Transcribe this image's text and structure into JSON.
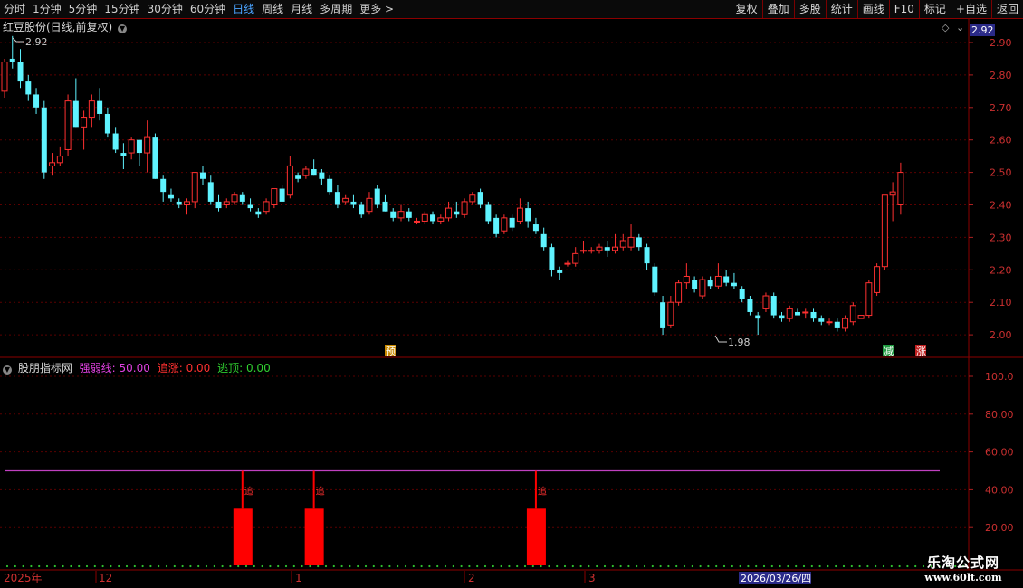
{
  "toolbar": {
    "periods": [
      "分时",
      "1分钟",
      "5分钟",
      "15分钟",
      "30分钟",
      "60分钟",
      "日线",
      "周线",
      "月线",
      "多周期",
      "更多 >"
    ],
    "active_period": "日线",
    "actions": [
      "复权",
      "叠加",
      "多股",
      "统计",
      "画线",
      "F10",
      "标记",
      "+自选",
      "返回"
    ]
  },
  "main_panel": {
    "title": "红豆股份(日线,前复权)",
    "current_price_label": "2.92",
    "high_label": "2.92",
    "low_label": "1.98",
    "price_axis": [
      "2.90",
      "2.80",
      "2.70",
      "2.60",
      "2.50",
      "2.40",
      "2.30",
      "2.20",
      "2.10",
      "2.00"
    ],
    "markers": [
      {
        "text": "预",
        "color": "#e0b000"
      },
      {
        "text": "减",
        "color": "#20b040"
      },
      {
        "text": "涨",
        "color": "#ff3030"
      }
    ]
  },
  "indicator_panel": {
    "title": "股朋指标网",
    "legend": [
      {
        "label": "强弱线: 50.00",
        "color": "#e040e0"
      },
      {
        "label": "追涨: 0.00",
        "color": "#ff3030"
      },
      {
        "label": "逃顶: 0.00",
        "color": "#30d030"
      }
    ],
    "axis": [
      "100.0",
      "80.00",
      "60.00",
      "40.00",
      "20.00"
    ],
    "signal_label": "追",
    "strength_line": 50
  },
  "time_axis": {
    "labels": [
      "2025年",
      "12",
      "1",
      "2",
      "3"
    ],
    "cursor_date": "2026/03/26/四"
  },
  "watermark": {
    "line1": "乐淘公式网",
    "line2": "www.60lt.com"
  },
  "chart_data": [
    {
      "type": "candlestick",
      "title": "红豆股份(日线,前复权)",
      "ylim": [
        1.95,
        2.95
      ],
      "up_color": "#ff3030",
      "down_color": "#5ff3ff",
      "candles": [
        [
          2.75,
          2.85,
          2.73,
          2.84
        ],
        [
          2.85,
          2.92,
          2.82,
          2.84
        ],
        [
          2.84,
          2.88,
          2.76,
          2.78
        ],
        [
          2.78,
          2.8,
          2.72,
          2.74
        ],
        [
          2.74,
          2.76,
          2.68,
          2.7
        ],
        [
          2.7,
          2.72,
          2.48,
          2.5
        ],
        [
          2.52,
          2.56,
          2.49,
          2.53
        ],
        [
          2.53,
          2.58,
          2.52,
          2.55
        ],
        [
          2.57,
          2.74,
          2.55,
          2.72
        ],
        [
          2.72,
          2.79,
          2.64,
          2.64
        ],
        [
          2.64,
          2.69,
          2.57,
          2.67
        ],
        [
          2.67,
          2.74,
          2.64,
          2.72
        ],
        [
          2.72,
          2.76,
          2.66,
          2.68
        ],
        [
          2.68,
          2.7,
          2.61,
          2.62
        ],
        [
          2.62,
          2.64,
          2.56,
          2.57
        ],
        [
          2.56,
          2.59,
          2.51,
          2.55
        ],
        [
          2.56,
          2.61,
          2.54,
          2.6
        ],
        [
          2.6,
          2.6,
          2.52,
          2.56
        ],
        [
          2.56,
          2.66,
          2.5,
          2.61
        ],
        [
          2.61,
          2.62,
          2.48,
          2.48
        ],
        [
          2.48,
          2.49,
          2.41,
          2.44
        ],
        [
          2.43,
          2.45,
          2.41,
          2.42
        ],
        [
          2.41,
          2.42,
          2.39,
          2.4
        ],
        [
          2.4,
          2.42,
          2.37,
          2.41
        ],
        [
          2.41,
          2.5,
          2.39,
          2.5
        ],
        [
          2.5,
          2.52,
          2.46,
          2.48
        ],
        [
          2.47,
          2.49,
          2.4,
          2.41
        ],
        [
          2.41,
          2.43,
          2.38,
          2.39
        ],
        [
          2.4,
          2.42,
          2.39,
          2.41
        ],
        [
          2.41,
          2.44,
          2.4,
          2.43
        ],
        [
          2.43,
          2.44,
          2.4,
          2.41
        ],
        [
          2.4,
          2.42,
          2.38,
          2.39
        ],
        [
          2.38,
          2.39,
          2.36,
          2.37
        ],
        [
          2.38,
          2.42,
          2.37,
          2.41
        ],
        [
          2.4,
          2.45,
          2.39,
          2.45
        ],
        [
          2.45,
          2.46,
          2.41,
          2.41
        ],
        [
          2.43,
          2.55,
          2.42,
          2.52
        ],
        [
          2.49,
          2.5,
          2.47,
          2.48
        ],
        [
          2.49,
          2.52,
          2.48,
          2.51
        ],
        [
          2.51,
          2.54,
          2.49,
          2.49
        ],
        [
          2.5,
          2.51,
          2.46,
          2.48
        ],
        [
          2.48,
          2.49,
          2.43,
          2.44
        ],
        [
          2.44,
          2.46,
          2.39,
          2.4
        ],
        [
          2.41,
          2.43,
          2.4,
          2.42
        ],
        [
          2.41,
          2.43,
          2.39,
          2.4
        ],
        [
          2.4,
          2.41,
          2.36,
          2.37
        ],
        [
          2.38,
          2.44,
          2.37,
          2.42
        ],
        [
          2.45,
          2.46,
          2.39,
          2.4
        ],
        [
          2.41,
          2.43,
          2.38,
          2.38
        ],
        [
          2.38,
          2.39,
          2.35,
          2.36
        ],
        [
          2.36,
          2.4,
          2.35,
          2.38
        ],
        [
          2.38,
          2.39,
          2.35,
          2.36
        ],
        [
          2.35,
          2.36,
          2.34,
          2.35
        ],
        [
          2.35,
          2.38,
          2.34,
          2.37
        ],
        [
          2.37,
          2.38,
          2.34,
          2.35
        ],
        [
          2.35,
          2.37,
          2.34,
          2.36
        ],
        [
          2.36,
          2.41,
          2.35,
          2.39
        ],
        [
          2.38,
          2.41,
          2.36,
          2.37
        ],
        [
          2.37,
          2.42,
          2.36,
          2.41
        ],
        [
          2.41,
          2.44,
          2.4,
          2.43
        ],
        [
          2.44,
          2.45,
          2.39,
          2.4
        ],
        [
          2.4,
          2.41,
          2.34,
          2.35
        ],
        [
          2.36,
          2.37,
          2.3,
          2.31
        ],
        [
          2.32,
          2.37,
          2.31,
          2.36
        ],
        [
          2.36,
          2.37,
          2.32,
          2.33
        ],
        [
          2.35,
          2.42,
          2.34,
          2.39
        ],
        [
          2.39,
          2.41,
          2.33,
          2.35
        ],
        [
          2.34,
          2.36,
          2.31,
          2.32
        ],
        [
          2.31,
          2.33,
          2.26,
          2.27
        ],
        [
          2.27,
          2.28,
          2.18,
          2.2
        ],
        [
          2.2,
          2.21,
          2.17,
          2.19
        ],
        [
          2.22,
          2.23,
          2.21,
          2.22
        ],
        [
          2.22,
          2.27,
          2.21,
          2.25
        ],
        [
          2.26,
          2.29,
          2.25,
          2.26
        ],
        [
          2.26,
          2.27,
          2.25,
          2.26
        ],
        [
          2.26,
          2.28,
          2.25,
          2.27
        ],
        [
          2.27,
          2.29,
          2.24,
          2.26
        ],
        [
          2.26,
          2.31,
          2.25,
          2.27
        ],
        [
          2.27,
          2.31,
          2.26,
          2.29
        ],
        [
          2.27,
          2.34,
          2.26,
          2.3
        ],
        [
          2.3,
          2.31,
          2.26,
          2.27
        ],
        [
          2.27,
          2.28,
          2.2,
          2.22
        ],
        [
          2.21,
          2.22,
          2.12,
          2.13
        ],
        [
          2.1,
          2.12,
          2.0,
          2.02
        ],
        [
          2.03,
          2.12,
          2.02,
          2.1
        ],
        [
          2.1,
          2.17,
          2.09,
          2.16
        ],
        [
          2.16,
          2.22,
          2.14,
          2.18
        ],
        [
          2.17,
          2.18,
          2.13,
          2.14
        ],
        [
          2.12,
          2.18,
          2.11,
          2.17
        ],
        [
          2.17,
          2.18,
          2.14,
          2.15
        ],
        [
          2.15,
          2.22,
          2.14,
          2.18
        ],
        [
          2.18,
          2.2,
          2.15,
          2.16
        ],
        [
          2.16,
          2.19,
          2.14,
          2.15
        ],
        [
          2.14,
          2.15,
          2.1,
          2.11
        ],
        [
          2.11,
          2.12,
          2.06,
          2.07
        ],
        [
          2.06,
          2.07,
          2.0,
          2.05
        ],
        [
          2.08,
          2.13,
          2.07,
          2.12
        ],
        [
          2.12,
          2.13,
          2.05,
          2.06
        ],
        [
          2.06,
          2.07,
          2.04,
          2.05
        ],
        [
          2.05,
          2.09,
          2.04,
          2.08
        ],
        [
          2.07,
          2.08,
          2.06,
          2.06
        ],
        [
          2.07,
          2.08,
          2.05,
          2.07
        ],
        [
          2.07,
          2.08,
          2.04,
          2.05
        ],
        [
          2.05,
          2.06,
          2.03,
          2.04
        ],
        [
          2.04,
          2.05,
          2.03,
          2.04
        ],
        [
          2.04,
          2.05,
          2.01,
          2.02
        ],
        [
          2.02,
          2.06,
          2.01,
          2.05
        ],
        [
          2.04,
          2.1,
          2.03,
          2.09
        ],
        [
          2.05,
          2.06,
          2.05,
          2.06
        ],
        [
          2.06,
          2.17,
          2.05,
          2.16
        ],
        [
          2.13,
          2.22,
          2.12,
          2.21
        ],
        [
          2.21,
          2.43,
          2.2,
          2.43
        ],
        [
          2.43,
          2.47,
          2.35,
          2.44
        ],
        [
          2.4,
          2.53,
          2.37,
          2.5
        ]
      ]
    },
    {
      "type": "bar",
      "title": "股朋指标网",
      "ylim": [
        0,
        110
      ],
      "series": [
        {
          "name": "强弱线",
          "values": [
            50
          ],
          "color": "#c040c0"
        },
        {
          "name": "追涨",
          "values": [
            30,
            30,
            30
          ],
          "color": "#ff0000"
        }
      ],
      "signal_candle_index": [
        30,
        39,
        67
      ]
    }
  ]
}
